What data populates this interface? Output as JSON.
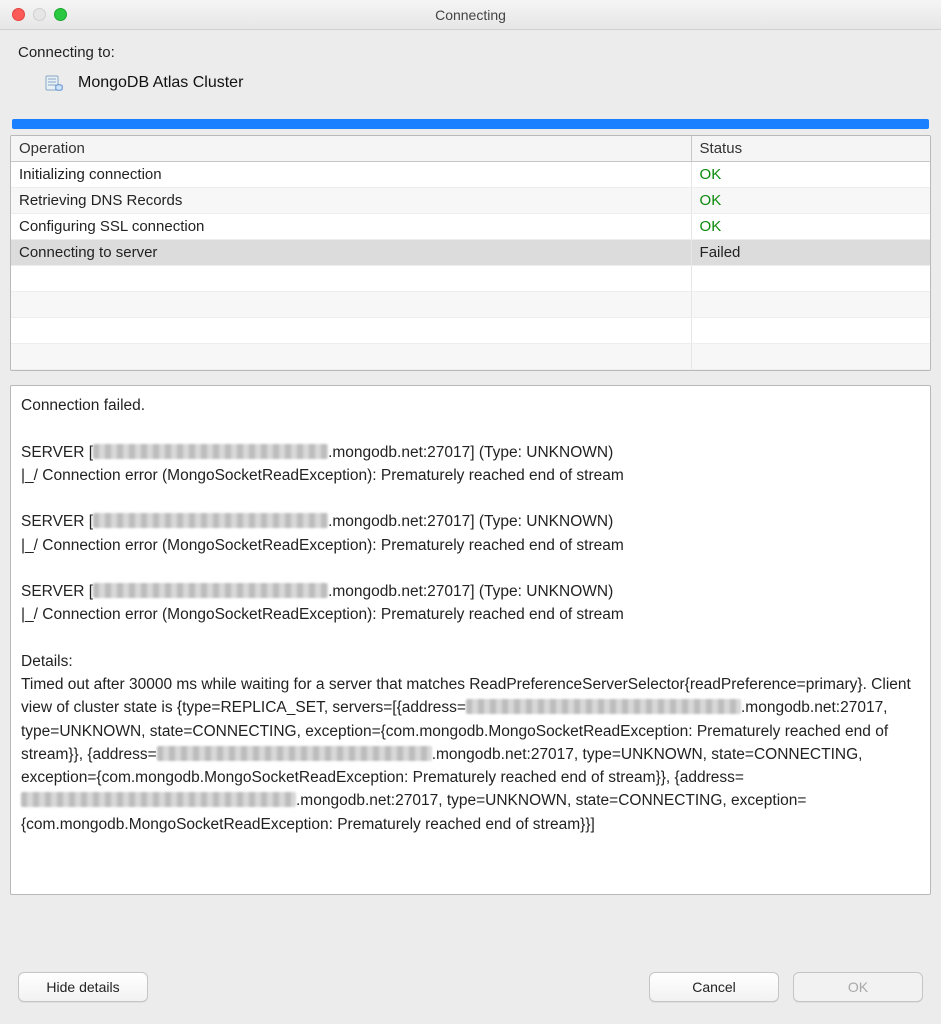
{
  "window": {
    "title": "Connecting"
  },
  "header": {
    "connecting_to_label": "Connecting to:",
    "target_name": "MongoDB Atlas Cluster"
  },
  "table": {
    "headers": {
      "operation": "Operation",
      "status": "Status"
    },
    "rows": [
      {
        "op": "Initializing connection",
        "status": "OK",
        "status_class": "ok",
        "selected": false
      },
      {
        "op": "Retrieving DNS Records",
        "status": "OK",
        "status_class": "ok",
        "selected": false
      },
      {
        "op": "Configuring SSL connection",
        "status": "OK",
        "status_class": "ok",
        "selected": false
      },
      {
        "op": "Connecting to server",
        "status": "Failed",
        "status_class": "failed",
        "selected": true
      },
      {
        "op": "",
        "status": "",
        "status_class": "",
        "selected": false
      },
      {
        "op": "",
        "status": "",
        "status_class": "",
        "selected": false
      },
      {
        "op": "",
        "status": "",
        "status_class": "",
        "selected": false
      },
      {
        "op": "",
        "status": "",
        "status_class": "",
        "selected": false
      }
    ]
  },
  "details": {
    "line1": "Connection failed.",
    "server_suffix": ".mongodb.net:27017] (Type: UNKNOWN)",
    "server_prefix": "SERVER [",
    "conn_err": "|_/ Connection error (MongoSocketReadException): Prematurely reached end of stream",
    "details_label": "Details:",
    "details_p1": "Timed out after 30000 ms while waiting for a server that matches ReadPreferenceServerSelector{readPreference=primary}. Client view of cluster state is {type=REPLICA_SET, servers=[{address=",
    "details_mid": ".mongodb.net:27017, type=UNKNOWN, state=CONNECTING, exception={com.mongodb.MongoSocketReadException: Prematurely reached end of stream}}, {address=",
    "details_end": ".mongodb.net:27017, type=UNKNOWN, state=CONNECTING, exception={com.mongodb.MongoSocketReadException: Prematurely reached end of stream}}]"
  },
  "buttons": {
    "hide_details": "Hide details",
    "cancel": "Cancel",
    "ok": "OK"
  }
}
